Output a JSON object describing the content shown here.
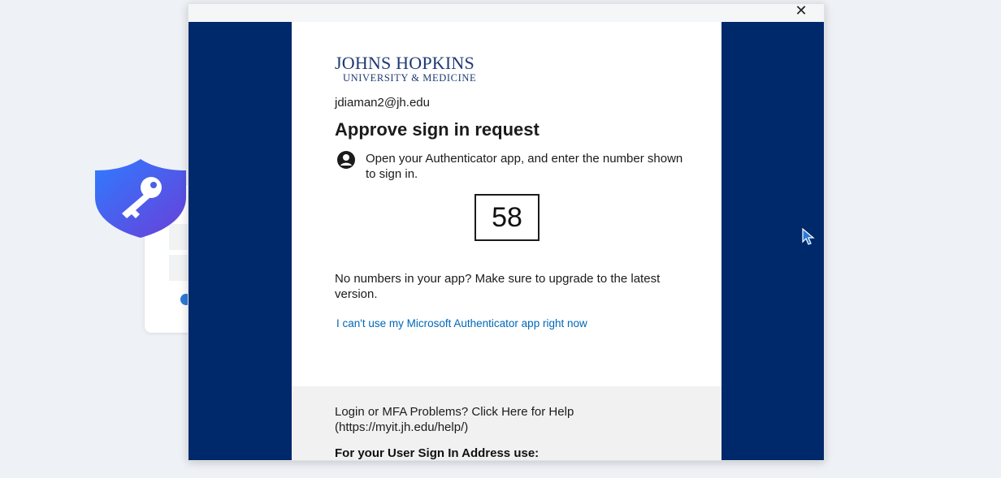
{
  "dialog": {
    "close_label": "✕"
  },
  "signin": {
    "logo": {
      "main": "JOHNS HOPKINS",
      "sub": "UNIVERSITY & MEDICINE"
    },
    "email": "jdiaman2@jh.edu",
    "title": "Approve sign in request",
    "instruction": "Open your Authenticator app, and enter the number shown to sign in.",
    "number": "58",
    "upgrade_note": "No numbers in your app? Make sure to upgrade to the latest version.",
    "cant_use_link": "I can't use my Microsoft Authenticator app right now"
  },
  "footer": {
    "help_text": "Login or MFA Problems? Click Here for Help (https://myit.jh.edu/help/)",
    "sign_in_address_label": "For your User Sign In Address use:"
  },
  "icons": {
    "shield": "shield-key-icon",
    "person": "person-icon",
    "close": "close-icon",
    "cursor": "mouse-pointer-icon"
  },
  "colors": {
    "brand_blue": "#00296b",
    "link_blue": "#0067b8",
    "shield_blue": "#2e6fe0"
  }
}
